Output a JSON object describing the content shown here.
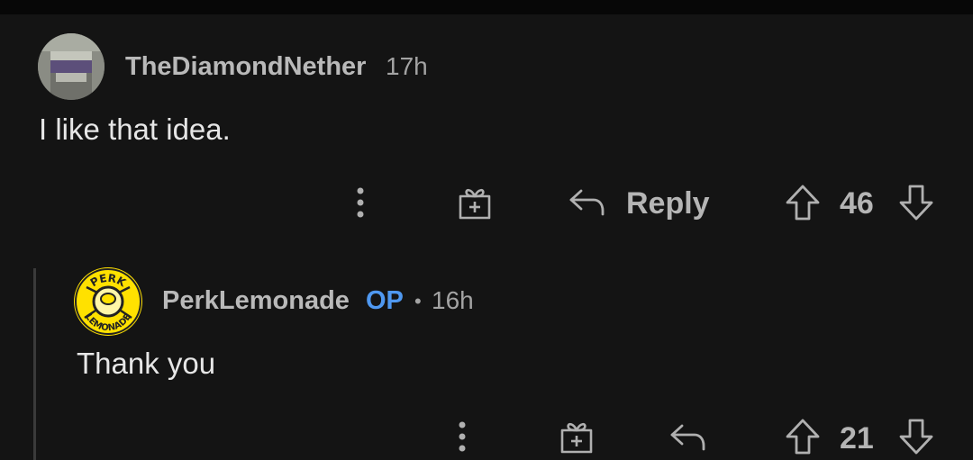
{
  "comments": [
    {
      "username": "TheDiamondNether",
      "time": "17h",
      "text": "I like that idea.",
      "reply_label": "Reply",
      "votes": "46",
      "avatar_icon": "pixel-avatar"
    },
    {
      "username": "PerkLemonade",
      "op_badge": "OP",
      "separator": "•",
      "time": "16h",
      "text": "Thank you",
      "votes": "21",
      "avatar_icon": "lemonade-logo-avatar",
      "avatar_logo_text_top": "PERK",
      "avatar_logo_text_bottom": "LEMONADE"
    }
  ],
  "colors": {
    "background": "#141414",
    "op_badge": "#4f98f0",
    "avatar_yellow": "#ffe100"
  }
}
